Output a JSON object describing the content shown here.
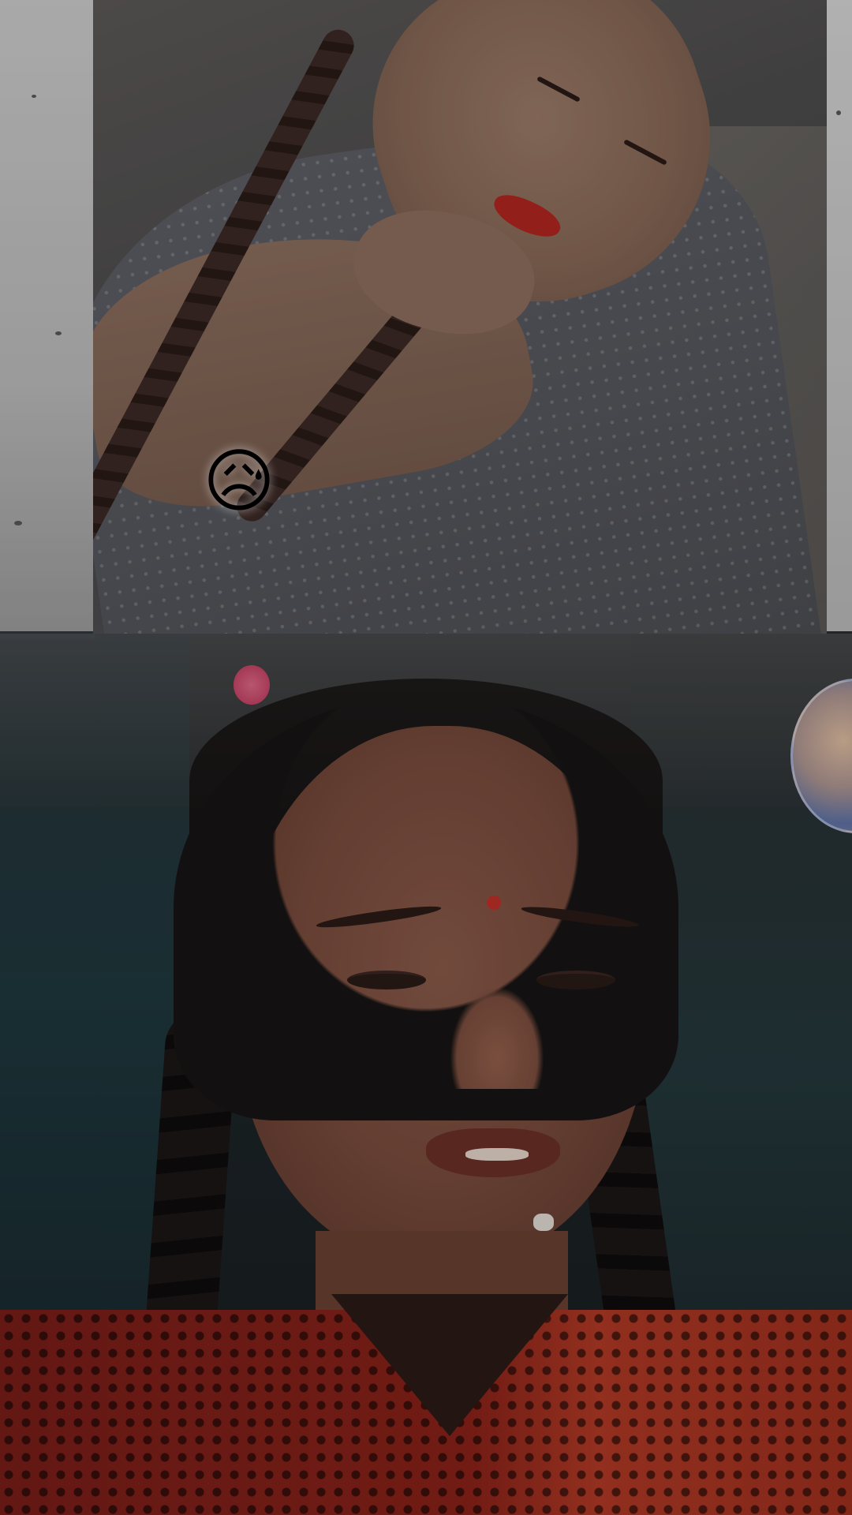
{
  "screen": {
    "type": "video-playback",
    "background_color": "#1b1d1f"
  },
  "overlay": {
    "emoji": "😥",
    "emoji_name": "sad-but-relieved-face-icon"
  },
  "avatar": {
    "icon": "profile-avatar"
  }
}
